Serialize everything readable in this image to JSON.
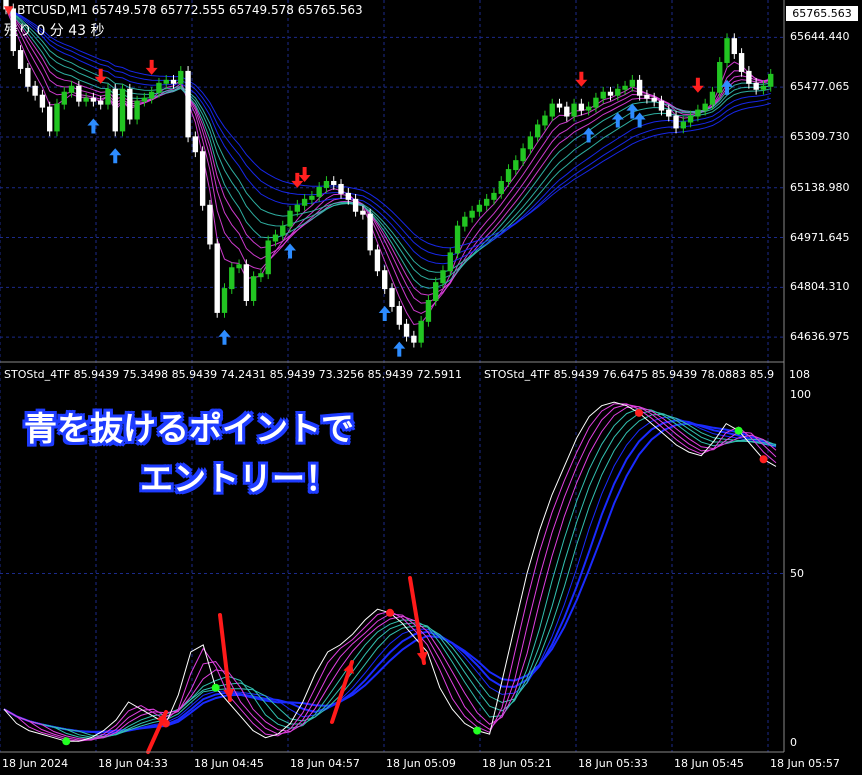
{
  "header": {
    "symbol": "BTCUSD,M1",
    "ohlc": "65749.578 65772.555 65749.578 65765.563",
    "countdown": "残り 0 分 43 秒"
  },
  "indicator_header": {
    "text1": "STOStd_4TF 85.9439 75.3498 85.9439 74.2431 85.9439 73.3256 85.9439 72.5911",
    "text2": "STOStd_4TF 85.9439 76.6475 85.9439 78.0883 85.9"
  },
  "annotation": {
    "line1": "青を抜けるポイントで",
    "line2": "エントリー！"
  },
  "colors": {
    "background": "#000000",
    "grid": "#1b2a8a",
    "bull_candle": "#22c522",
    "bear_candle": "#ffffff",
    "band_blue": "#1a2bff",
    "band_magenta": "#e040e0",
    "band_teal": "#33c0b0",
    "arrow_up": "#2d8cff",
    "arrow_down": "#ff2020",
    "annotation_arrow": "#ff1a1a"
  },
  "chart_data": [
    {
      "type": "candlestick",
      "title": "BTCUSD,M1",
      "ylim": [
        64560,
        65770
      ],
      "y_ticks": [
        65644.44,
        65477.065,
        65309.73,
        65138.98,
        64971.645,
        64804.31,
        64636.975
      ],
      "y_tick_labels": [
        "65644.440",
        "65477.065",
        "65309.730",
        "65138.980",
        "64971.645",
        "64804.310",
        "64636.975"
      ],
      "current_price": "65765.563",
      "x_ticks": [
        "18 Jun 2024",
        "18 Jun 04:33",
        "18 Jun 04:45",
        "18 Jun 04:57",
        "18 Jun 05:09",
        "18 Jun 05:21",
        "18 Jun 05:33",
        "18 Jun 05:45",
        "18 Jun 05:57"
      ],
      "close": [
        65740,
        65600,
        65540,
        65480,
        65450,
        65410,
        65330,
        65420,
        65460,
        65480,
        65430,
        65440,
        65430,
        65420,
        65470,
        65330,
        65470,
        65370,
        65430,
        65440,
        65460,
        65490,
        65500,
        65490,
        65530,
        65310,
        65260,
        65080,
        64950,
        64720,
        64800,
        64870,
        64880,
        64760,
        64840,
        64850,
        64960,
        64980,
        65010,
        65060,
        65080,
        65100,
        65110,
        65140,
        65160,
        65150,
        65120,
        65100,
        65060,
        65050,
        64930,
        64860,
        64800,
        64740,
        64680,
        64640,
        64620,
        64690,
        64760,
        64820,
        64860,
        64920,
        65010,
        65040,
        65060,
        65080,
        65100,
        65120,
        65160,
        65200,
        65230,
        65270,
        65310,
        65350,
        65380,
        65420,
        65410,
        65380,
        65420,
        65400,
        65410,
        65440,
        65460,
        65450,
        65470,
        65480,
        65500,
        65450,
        65440,
        65430,
        65400,
        65380,
        65340,
        65360,
        65380,
        65400,
        65420,
        65460,
        65560,
        65640,
        65590,
        65530,
        65490,
        65470,
        65480,
        65520
      ],
      "open": [
        65770,
        65740,
        65600,
        65540,
        65480,
        65450,
        65410,
        65330,
        65420,
        65460,
        65480,
        65430,
        65440,
        65430,
        65420,
        65470,
        65330,
        65470,
        65370,
        65430,
        65440,
        65460,
        65490,
        65500,
        65490,
        65530,
        65310,
        65260,
        65080,
        64950,
        64720,
        64800,
        64870,
        64880,
        64760,
        64840,
        64850,
        64960,
        64980,
        65010,
        65060,
        65080,
        65100,
        65110,
        65140,
        65160,
        65150,
        65120,
        65100,
        65060,
        65050,
        64930,
        64860,
        64800,
        64740,
        64680,
        64640,
        64620,
        64690,
        64760,
        64820,
        64860,
        64920,
        65010,
        65040,
        65060,
        65080,
        65100,
        65120,
        65160,
        65200,
        65230,
        65270,
        65310,
        65350,
        65380,
        65420,
        65410,
        65380,
        65420,
        65400,
        65410,
        65440,
        65460,
        65450,
        65470,
        65480,
        65500,
        65450,
        65440,
        65430,
        65400,
        65380,
        65340,
        65360,
        65380,
        65400,
        65420,
        65460,
        65560,
        65640,
        65590,
        65530,
        65490,
        65470,
        65480
      ],
      "up_arrows": [
        12,
        15,
        30,
        39,
        52,
        54,
        80,
        84,
        86,
        87,
        99
      ],
      "down_arrows": [
        13,
        20,
        40,
        41,
        79,
        95
      ]
    },
    {
      "type": "line",
      "title": "STOStd_4TF",
      "ylim": [
        0,
        100
      ],
      "y_ticks": [
        0,
        50,
        100
      ],
      "y_tick_labels": [
        "0",
        "50",
        "100"
      ],
      "top_label": "108",
      "main_line": [
        12,
        8,
        6,
        5,
        4,
        3,
        3,
        4,
        6,
        9,
        14,
        12,
        10,
        8,
        16,
        28,
        30,
        18,
        14,
        10,
        6,
        4,
        5,
        8,
        14,
        22,
        28,
        30,
        33,
        37,
        40,
        39,
        36,
        32,
        28,
        18,
        12,
        8,
        6,
        5,
        20,
        35,
        50,
        62,
        72,
        80,
        88,
        94,
        97,
        98,
        97,
        95,
        92,
        89,
        86,
        84,
        83,
        87,
        92,
        90,
        86,
        82,
        80
      ],
      "dots_green": [
        5,
        17,
        38,
        59
      ],
      "dots_red": [
        13,
        31,
        51,
        61
      ]
    }
  ]
}
